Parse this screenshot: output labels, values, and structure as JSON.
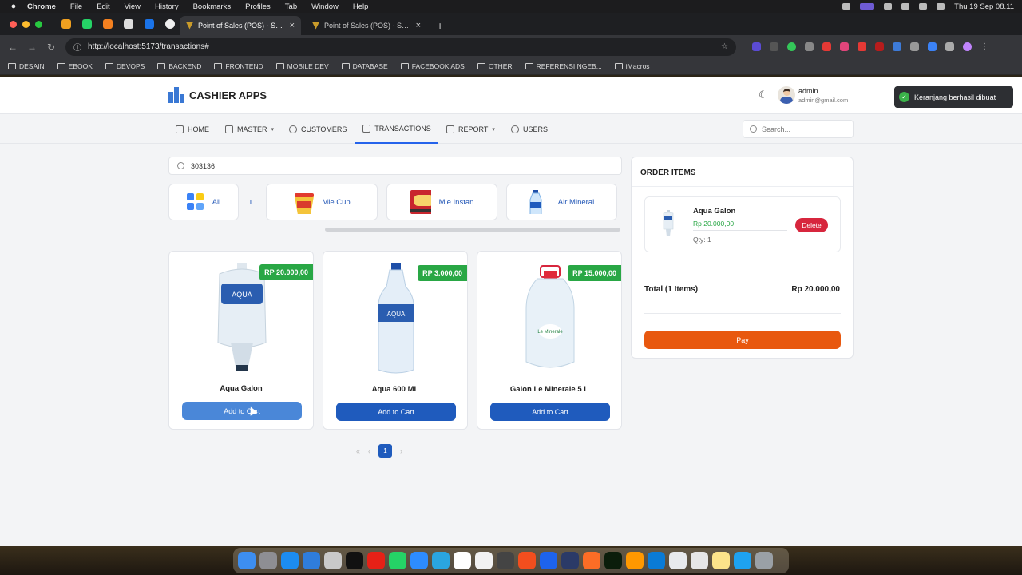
{
  "menubar": {
    "app": "Chrome",
    "items": [
      "File",
      "Edit",
      "View",
      "History",
      "Bookmarks",
      "Profiles",
      "Tab",
      "Window",
      "Help"
    ],
    "clock": "Thu 19 Sep  08.11"
  },
  "browser": {
    "tabs": [
      {
        "title": "Point of Sales (POS) - Santri",
        "active": true
      },
      {
        "title": "Point of Sales (POS) - Santri",
        "active": false
      }
    ],
    "url": "http://localhost:5173/transactions#",
    "bookmarks": [
      "DESAIN",
      "EBOOK",
      "DEVOPS",
      "BACKEND",
      "FRONTEND",
      "MOBILE DEV",
      "DATABASE",
      "FACEBOOK ADS",
      "OTHER",
      "REFERENSI NGEB...",
      "iMacros"
    ]
  },
  "app": {
    "title": "CASHIER APPS",
    "user": {
      "name": "admin",
      "email": "admin@gmail.com"
    },
    "nav": {
      "home": "HOME",
      "master": "MASTER",
      "customers": "CUSTOMERS",
      "transactions": "TRANSACTIONS",
      "report": "REPORT",
      "users": "USERS"
    },
    "search_placeholder": "Search...",
    "toast": "Keranjang berhasil dibuat"
  },
  "pos": {
    "barcode_value": "303136",
    "categories": {
      "all": "All",
      "partial": "ı",
      "mie_cup": "Mie Cup",
      "mie_instan": "Mie Instan",
      "air_mineral": "Air Mineral"
    },
    "products": [
      {
        "name": "Aqua Galon",
        "price": "RP 20.000,00",
        "button": "Add to Cart"
      },
      {
        "name": "Aqua 600 ML",
        "price": "RP 3.000,00",
        "button": "Add to Cart"
      },
      {
        "name": "Galon Le Minerale 5 L",
        "price": "RP 15.000,00",
        "button": "Add to Cart"
      }
    ],
    "pagination": {
      "prev_first": "«",
      "prev": "‹",
      "current": "1",
      "next": "›"
    }
  },
  "order": {
    "heading": "ORDER ITEMS",
    "items": [
      {
        "name": "Aqua Galon",
        "price": "Rp 20.000,00",
        "qty": "Qty: 1",
        "delete_label": "Delete"
      }
    ],
    "total_label": "Total (1 Items)",
    "total_value": "Rp 20.000,00",
    "pay_label": "Pay"
  },
  "colors": {
    "primary": "#1f5bbd",
    "price_badge": "#29a745",
    "delete": "#d7263d",
    "pay": "#e8580f"
  }
}
